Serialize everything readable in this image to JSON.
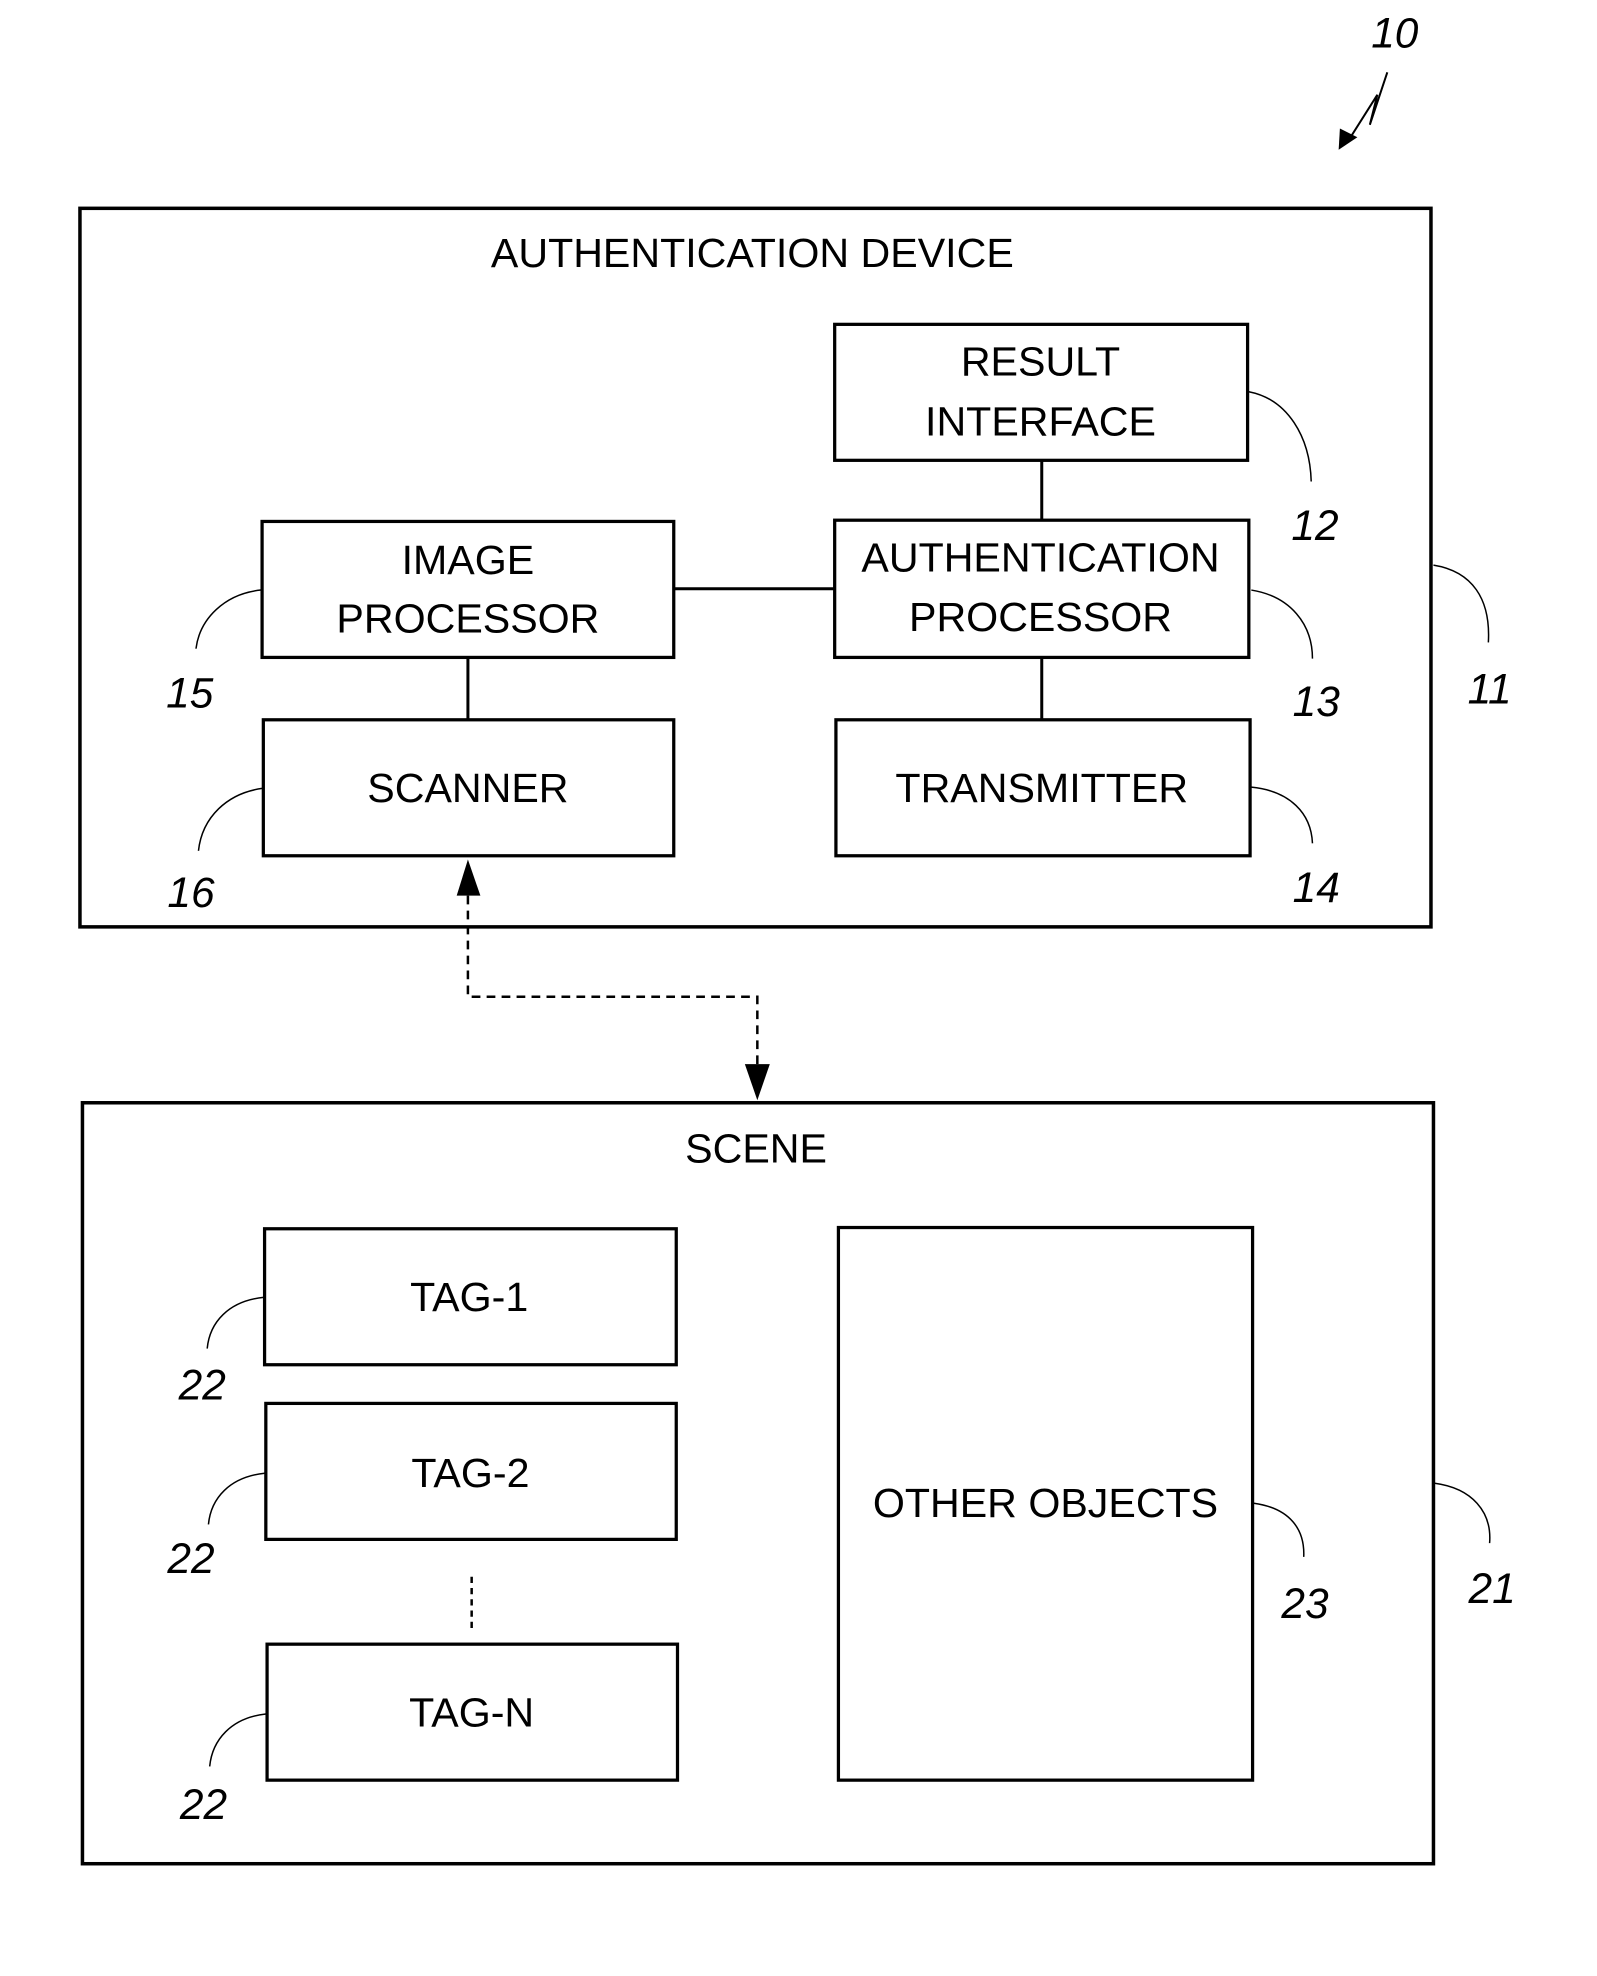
{
  "figure": {
    "reference": "10",
    "authentication_device": {
      "title": "AUTHENTICATION DEVICE",
      "ref": "11",
      "blocks": {
        "result_interface": {
          "lines": [
            "RESULT",
            "INTERFACE"
          ],
          "ref": "12"
        },
        "authentication_processor": {
          "lines": [
            "AUTHENTICATION",
            "PROCESSOR"
          ],
          "ref": "13"
        },
        "transmitter": {
          "lines": [
            "TRANSMITTER"
          ],
          "ref": "14"
        },
        "image_processor": {
          "lines": [
            "IMAGE",
            "PROCESSOR"
          ],
          "ref": "15"
        },
        "scanner": {
          "lines": [
            "SCANNER"
          ],
          "ref": "16"
        }
      }
    },
    "scene": {
      "title": "SCENE",
      "ref": "21",
      "tags": [
        {
          "label": "TAG-1",
          "ref": "22"
        },
        {
          "label": "TAG-2",
          "ref": "22"
        },
        {
          "label": "TAG-N",
          "ref": "22"
        }
      ],
      "other_objects": {
        "label": "OTHER OBJECTS",
        "ref": "23"
      }
    }
  }
}
